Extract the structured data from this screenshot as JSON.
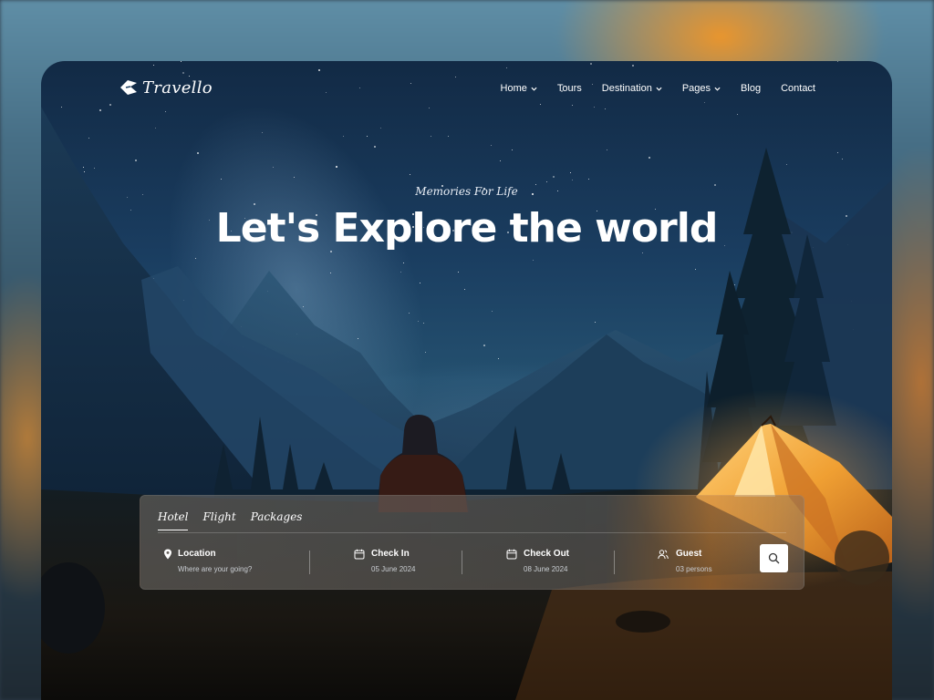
{
  "brand": {
    "name": "Travello"
  },
  "nav": {
    "items": [
      {
        "label": "Home",
        "has_dropdown": true
      },
      {
        "label": "Tours",
        "has_dropdown": false
      },
      {
        "label": "Destination",
        "has_dropdown": true
      },
      {
        "label": "Pages",
        "has_dropdown": true
      },
      {
        "label": "Blog",
        "has_dropdown": false
      },
      {
        "label": "Contact",
        "has_dropdown": false
      }
    ]
  },
  "hero": {
    "tagline": "Memories For Life",
    "title": "Let's Explore the world"
  },
  "search": {
    "tabs": [
      {
        "label": "Hotel",
        "active": true
      },
      {
        "label": "Flight",
        "active": false
      },
      {
        "label": "Packages",
        "active": false
      }
    ],
    "fields": [
      {
        "label": "Location",
        "value": "Where are your going?",
        "icon": "location-pin-icon"
      },
      {
        "label": "Check In",
        "value": "05 June 2024",
        "icon": "calendar-icon"
      },
      {
        "label": "Check Out",
        "value": "08 June 2024",
        "icon": "calendar-icon"
      },
      {
        "label": "Guest",
        "value": "03 persons",
        "icon": "users-icon"
      }
    ],
    "button_icon": "search-icon"
  },
  "colors": {
    "sky": "#1a3d60",
    "tent": "#f0a033",
    "text": "#ffffff"
  }
}
